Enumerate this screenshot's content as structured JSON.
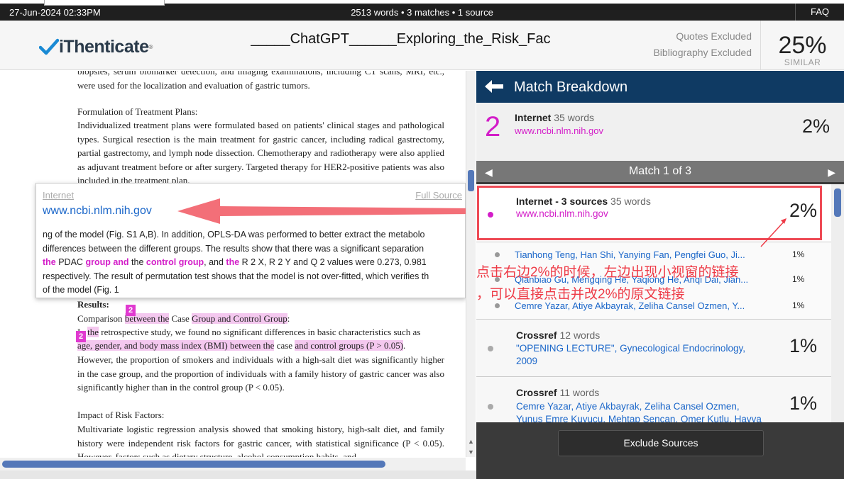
{
  "topbar": {
    "date": "27-Jun-2024 02:33PM",
    "stats": "2513 words • 3 matches • 1 source",
    "faq": "FAQ"
  },
  "header": {
    "brand": "iThenticate",
    "doc_title": "_____ChatGPT______Exploring_the_Risk_Fac",
    "quotes": "Quotes Excluded",
    "bibliography": "Bibliography Excluded",
    "similarity": "25%",
    "similar_label": "SIMILAR"
  },
  "document": {
    "p0": "biopsies, serum biomarker detection, and imaging examinations, including CT scans, MRI, etc., were used for the localization and evaluation of gastric tumors.",
    "p1_title": "Formulation of Treatment Plans:",
    "p1": "Individualized treatment plans were formulated based on patients' clinical stages and pathological types. Surgical resection is the main treatment for gastric cancer, including radical gastrectomy, partial gastrectomy, and lymph node dissection. Chemotherapy and radiotherapy were also applied as adjuvant treatment before or after surgery. Targeted therapy for HER2-positive patients was also included in the treatment plan.",
    "results_title": "Results:",
    "comp_a": "Comparison ",
    "comp_hl1": "between the",
    "comp_b": " Case ",
    "comp_hl2": "Group and Control Group",
    "comp_c": ":",
    "r1_a": "In ",
    "r1_hl": "the",
    "r1_b": " retrospective study, we found no significant differences in basic characteristics such as",
    "r2_hl1": "age, gender, and body mass index (BMI) between the",
    "r2_b": " case ",
    "r2_hl2": "and control groups (P > 0.05)",
    "r2_c": ".",
    "r3": "However, the proportion of smokers and individuals with a high-salt diet was significantly higher in the case group, and the proportion of individuals with a family history of gastric cancer was also significantly higher than in the control group (P < 0.05).",
    "impact_title": "Impact of Risk Factors:",
    "impact": "Multivariate logistic regression analysis showed that smoking history, high-salt diet, and family history were independent risk factors for gastric cancer, with statistical significance (P < 0.05). However, factors such as dietary structure, alcohol consumption habits, and",
    "marker1": "2",
    "marker2": "2"
  },
  "popup": {
    "source_type": "Internet",
    "full_source": "Full Source",
    "url": "www.ncbi.nlm.nih.gov",
    "l1": "ng of the model (Fig. S1 A,B). In addition, OPLS-DA was performed to better extract the metabolo",
    "l2": "differences between the different groups. The results show that there was a significant separation",
    "l3_m1": "the",
    "l3_a": " PDAC ",
    "l3_m2": "group and",
    "l3_b": " the ",
    "l3_m3": "control group",
    "l3_c": ", and ",
    "l3_m4": "the",
    "l3_d": " R 2 X, R 2 Y and Q 2 values were 0.273, 0.981",
    "l4": "respectively. The result of permutation test shows that the model is not over-fitted, which verifies th",
    "l5": "of the model (Fig. 1"
  },
  "panel": {
    "title": "Match Breakdown",
    "summary": {
      "number": "2",
      "type": "Internet",
      "words": "35 words",
      "url": "www.ncbi.nlm.nih.gov",
      "pct": "2%"
    },
    "match_nav": "Match 1 of 3",
    "items": [
      {
        "type": "Internet - 3 sources",
        "words": "35 words",
        "link": "www.ncbi.nlm.nih.gov",
        "pct": "2%"
      },
      {
        "type": "Crossref",
        "words": "12 words",
        "link": "\"OPENING LECTURE\", Gynecological Endocrinology, 2009",
        "pct": "1%"
      },
      {
        "type": "Crossref",
        "words": "11 words",
        "link": "Cemre Yazar, Atiye Akbayrak, Zeliha Cansel Ozmen, Yunus Emre Kuyucu, Mehtap Sencan, Omer Kutlu, Havva Yil",
        "pct": "1%"
      }
    ],
    "subitems": [
      {
        "link": "Tianhong Teng, Han Shi, Yanying Fan, Pengfei Guo, Ji...",
        "pct": "1%"
      },
      {
        "link": "Qianbiao Gu, Mengqing He, Yaqiong He, Anqi Dai, Jian...",
        "pct": "1%"
      },
      {
        "link": "Cemre Yazar, Atiye Akbayrak, Zeliha Cansel Ozmen, Y...",
        "pct": "1%"
      }
    ],
    "exclude": "Exclude Sources"
  },
  "annotation": {
    "line1": "点击右边2%的时候，左边出现小视窗的链接",
    "line2": "，可以直接点击并改2%的原文链接"
  },
  "colors": {
    "accent": "#d31dc8",
    "link": "#1a66c9",
    "header": "#0f3a63",
    "annotation": "#ee3b47"
  }
}
